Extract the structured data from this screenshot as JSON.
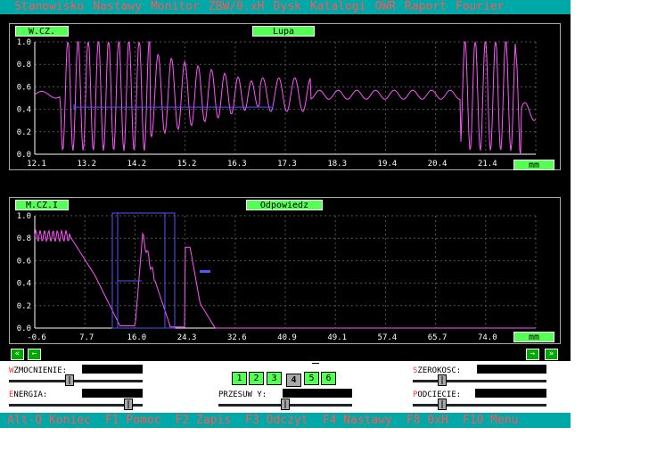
{
  "menu": [
    "Stanowisko",
    "Nastawy",
    "Monitor",
    "ZBW/0.xH",
    "Dysk",
    "Katalogi",
    "OWR",
    "Raport",
    "Fourier"
  ],
  "top_panel": {
    "label": "W.CZ.",
    "title": "Lupa",
    "unit": "mm",
    "y_ticks": [
      "1.0",
      "0.8",
      "0.6",
      "0.4",
      "0.2",
      "0.0"
    ],
    "x_ticks": [
      "12.1",
      "13.2",
      "14.2",
      "15.2",
      "16.3",
      "17.3",
      "18.3",
      "19.4",
      "20.4",
      "21.4"
    ]
  },
  "bottom_panel": {
    "label": "M.CZ.I",
    "title": "Odpowiedz",
    "unit": "mm",
    "y_ticks": [
      "1.0",
      "0.8",
      "0.6",
      "0.4",
      "0.2",
      "0.0"
    ],
    "x_ticks": [
      "-0.6",
      "7.7",
      "16.0",
      "24.3",
      "32.6",
      "40.9",
      "49.1",
      "57.4",
      "65.7",
      "74.0"
    ]
  },
  "nav": {
    "first": "«",
    "prev": "←",
    "next": "→",
    "last": "»"
  },
  "controls": {
    "wzmocnienie": {
      "first": "W",
      "rest": "ZMOCNIENIE:",
      "level": 0.45
    },
    "energia": {
      "first": "E",
      "rest": "NERGIA:",
      "level": 0.92
    },
    "przesuw": {
      "first": "",
      "rest": "PRZESUW Y:",
      "level": 0.5
    },
    "szerokosc": {
      "first": "S",
      "rest": "ZEROKOSC:",
      "level": 0.2
    },
    "podciecie": {
      "first": "P",
      "rest": "ODCIECIE:",
      "level": 0.2
    },
    "numbers": [
      "1",
      "2",
      "3",
      "4",
      "5",
      "6"
    ],
    "active_number": "4"
  },
  "status": [
    "Alt-Q Koniec",
    "F1 Pomoc",
    "F2 Zapis",
    "F3 Odczyt",
    "F4 Nastawy",
    "F8 0xH",
    "F10 Menu"
  ],
  "colors": {
    "signal": "#ff55ff",
    "cursor": "#5555ff",
    "grid": "#555555",
    "accent": "#55ff55",
    "bar": "#00a8a8"
  }
}
